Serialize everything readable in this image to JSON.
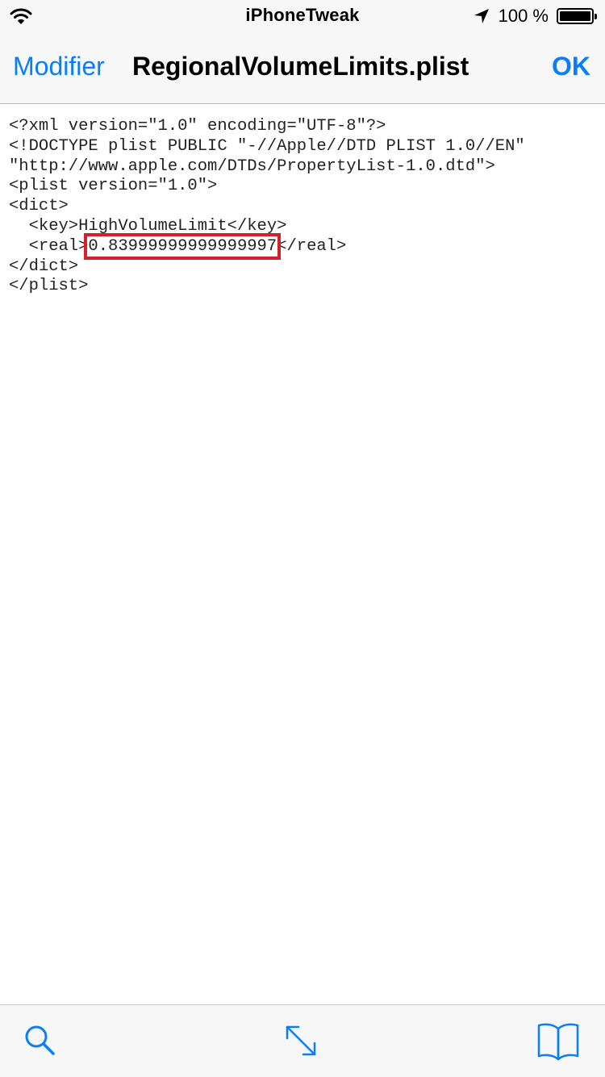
{
  "status_bar": {
    "carrier": "iPhoneTweak",
    "battery_text": "100 %",
    "battery_level": 1.0,
    "icons": [
      "wifi-icon",
      "location-arrow-icon",
      "battery-icon"
    ]
  },
  "nav_bar": {
    "left_button": "Modifier",
    "title": "RegionalVolumeLimits.plist",
    "right_button": "OK",
    "accent_color": "#0a7ef8"
  },
  "editor": {
    "lines": [
      "<?xml version=\"1.0\" encoding=\"UTF-8\"?>",
      "<!DOCTYPE plist PUBLIC \"-//Apple//DTD PLIST 1.0//EN\"",
      "\"http://www.apple.com/DTDs/PropertyList-1.0.dtd\">",
      "<plist version=\"1.0\">",
      "<dict>",
      "  <key>HighVolumeLimit</key>"
    ],
    "real_line": {
      "prefix": "  <real>",
      "value": "0.83999999999999997",
      "suffix": "</real>"
    },
    "closing_lines": [
      "</dict>",
      "</plist>"
    ],
    "highlight_color": "#d71f2c"
  },
  "toolbar": {
    "icons": [
      "search-icon",
      "expand-arrows-icon",
      "book-icon"
    ]
  }
}
